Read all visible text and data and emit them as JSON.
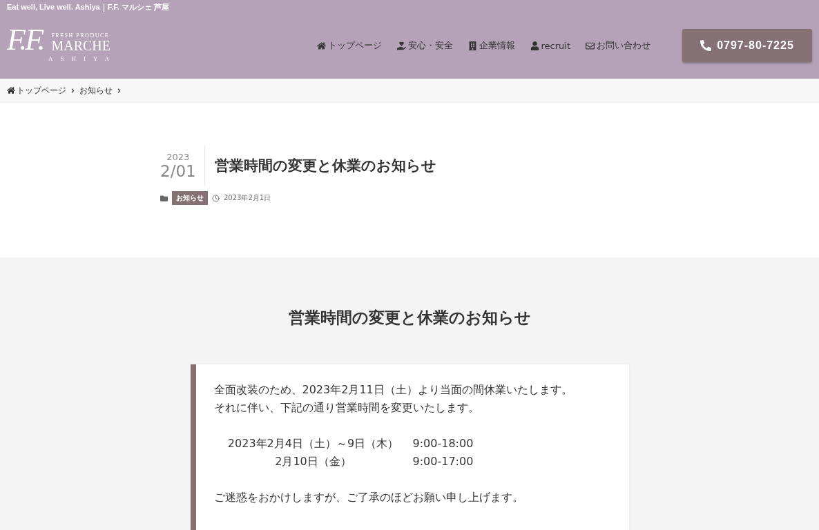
{
  "top_bar": {
    "tagline": "Eat well, Live well. Ashiya｜F.F. マルシェ 芦屋"
  },
  "logo": {
    "monogram": "F.F.",
    "subtitle": "FRESH PRODUCE",
    "name": "MARCHE",
    "place": "ASHIYA"
  },
  "nav": [
    {
      "kind": "home",
      "label": "トップページ"
    },
    {
      "kind": "hand",
      "label": "安心・安全"
    },
    {
      "kind": "building",
      "label": "企業情報"
    },
    {
      "kind": "user",
      "label": "recruit"
    },
    {
      "kind": "mail",
      "label": "お問い合わせ"
    }
  ],
  "phone_button": {
    "label": "0797-80-7225"
  },
  "breadcrumb": [
    {
      "kind": "home",
      "label": "トップページ"
    },
    {
      "kind": "page",
      "label": "お知らせ"
    }
  ],
  "post": {
    "year": "2023",
    "day": "2/01",
    "title": "営業時間の変更と休業のお知らせ",
    "category": "お知らせ",
    "date": "2023年2月1日"
  },
  "content": {
    "heading": "営業時間の変更と休業のお知らせ",
    "intro": [
      "全面改装のため、2023年2月11日（土）より当面の間休業いたします。",
      "それに伴い、下記の通り営業時間を変更いたします。"
    ],
    "schedule": [
      {
        "dates": "2023年2月4日（土）～9日（木）",
        "hours": "9:00-18:00"
      },
      {
        "dates": "2月10日（金）",
        "hours": "9:00-17:00"
      }
    ],
    "closing": "ご迷惑をおかけしますが、ご了承のほどお願い申し上げます。"
  }
}
